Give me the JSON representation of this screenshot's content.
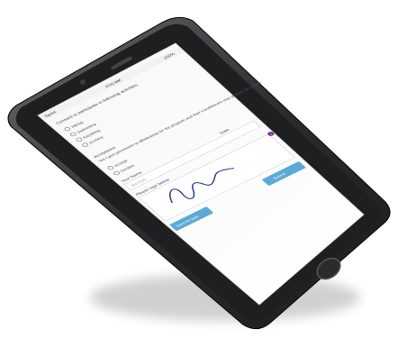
{
  "status_bar": {
    "carrier": "Sprint",
    "time": "9:02 AM",
    "battery": "100%"
  },
  "form": {
    "question1": "Consent to participate in following activities:",
    "activities": [
      "Hiking",
      "Swimming",
      "Kayaking",
      "Archery"
    ],
    "acceptance_label": "Acceptance",
    "acceptance_text": "Yes I give permission to offsite/away for the program and their Conditioners stay profiled up to date",
    "options": [
      "Accept",
      "Decline"
    ],
    "your_name_label": "Your Name",
    "your_name_value": "Jon Doe",
    "date_label": "Date",
    "signature_label": "Please sign below",
    "save_label": "Save for later",
    "submit_label": "Submit",
    "badge_count": "1"
  },
  "colors": {
    "device_frame": "#2b2c2e",
    "screen_bg": "#ffffff",
    "text_dark": "#4a4f55",
    "input_border": "#c9cdd2",
    "button_blue": "#5aa9d6",
    "signature_ink": "#2a3f8f",
    "badge": "#7a2a8e"
  }
}
